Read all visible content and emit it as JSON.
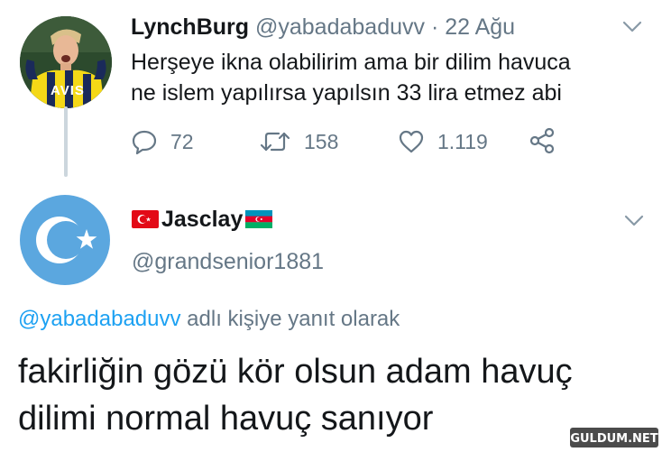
{
  "original_tweet": {
    "display_name": "LynchBurg",
    "handle": "@yabadabaduvv",
    "separator": "·",
    "date": "22 Ağu",
    "text_lines": [
      "Herşeye ikna olabilirim ama bir dilim havuca",
      "ne islem yapılırsa yapılsın 33 lira etmez abi"
    ],
    "avatar_jersey_text": "AVIS",
    "actions": {
      "reply": {
        "icon": "reply-icon",
        "count": "72"
      },
      "retweet": {
        "icon": "retweet-icon",
        "count": "158"
      },
      "like": {
        "icon": "heart-icon",
        "count": "1.119"
      },
      "share": {
        "icon": "share-icon"
      }
    }
  },
  "reply_tweet": {
    "display_name": "Jasclay",
    "handle": "@grandsenior1881",
    "replying_to_mention": "@yabadabaduvv",
    "replying_to_suffix": "adlı kişiye yanıt olarak",
    "text_lines": [
      "fakirliğin gözü kör olsun adam havuç",
      "dilimi normal havuç sanıyor"
    ],
    "flags": [
      "turkey-flag-icon",
      "azerbaijan-flag-icon"
    ]
  },
  "watermark": "GULDUM.NET",
  "colors": {
    "text": "#14171a",
    "secondary": "#657786",
    "link": "#1da1f2",
    "thread_line": "#ccd6dd",
    "avatar2_bg": "#5ba7df"
  }
}
